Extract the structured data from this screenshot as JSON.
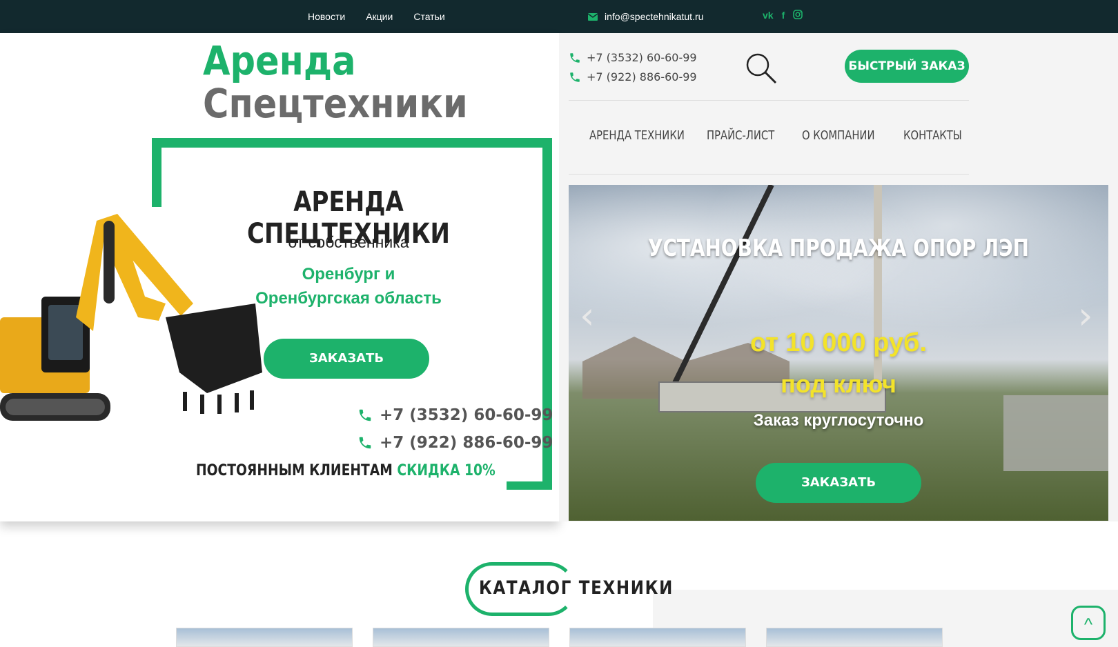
{
  "topbar": {
    "nav": [
      "Новости",
      "Акции",
      "Статьи"
    ],
    "email": "info@spectehnikatut.ru",
    "social": [
      "vk-icon",
      "facebook-icon",
      "instagram-icon"
    ]
  },
  "logo": {
    "line1": "Аренда",
    "line2": "Спецтехники"
  },
  "hero": {
    "title": "АРЕНДА СПЕЦТЕХНИКИ",
    "subtitle": "от собственника",
    "region_line1": "Оренбург и",
    "region_line2": "Оренбургская область",
    "order_button": "ЗАКАЗАТЬ",
    "phones": [
      "+7 (3532) 60-60-99",
      "+7 (922) 886-60-99"
    ],
    "promo_prefix": "ПОСТОЯННЫМ КЛИЕНТАМ",
    "promo_highlight": "СКИДКА 10%"
  },
  "header": {
    "phones": [
      "+7 (3532) 60-60-99",
      "+7 (922) 886-60-99"
    ],
    "quick_order": "БЫСТРЫЙ ЗАКАЗ",
    "nav": [
      "АРЕНДА ТЕХНИКИ",
      "ПРАЙС-ЛИСТ",
      "О КОМПАНИИ",
      "КОНТАКТЫ"
    ]
  },
  "slider": {
    "title": "УСТАНОВКА ПРОДАЖА ОПОР ЛЭП",
    "price": "от 10 000 руб.",
    "key": "под ключ",
    "note": "Заказ круглосуточно",
    "order_button": "ЗАКАЗАТЬ",
    "prev": "‹",
    "next": "›"
  },
  "catalog": {
    "title": "КАТАЛОГ ТЕХНИКИ"
  },
  "scroll_top": "^",
  "colors": {
    "accent": "#1db26b",
    "topbar": "#12292e",
    "slide_text": "#f3e32a"
  }
}
